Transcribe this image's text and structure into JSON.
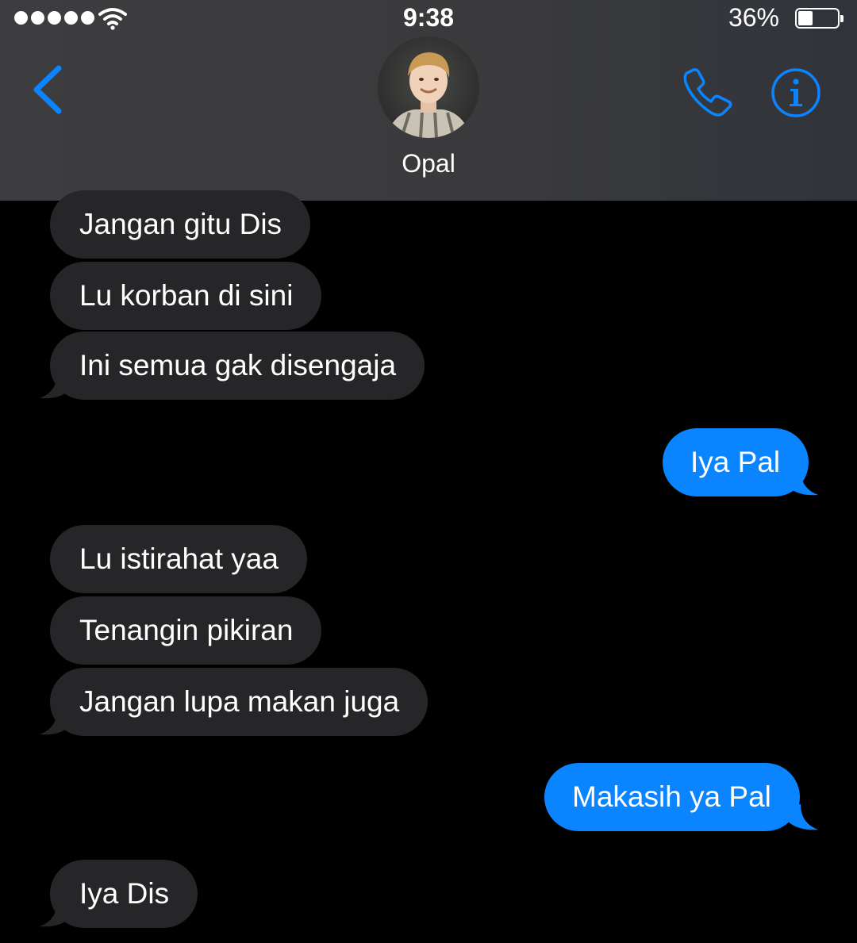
{
  "status_bar": {
    "time": "9:38",
    "battery_percent": "36%",
    "signal_bars": 5,
    "battery_level": 0.36
  },
  "header": {
    "contact_name": "Opal",
    "back_icon": "chevron-left-icon",
    "call_icon": "phone-icon",
    "info_icon": "info-icon",
    "accent_color": "#0a84ff"
  },
  "messages": [
    {
      "direction": "in",
      "text": "Jangan gitu Dis"
    },
    {
      "direction": "in",
      "text": "Lu korban di sini"
    },
    {
      "direction": "in",
      "text": "Ini semua gak disengaja"
    },
    {
      "direction": "out",
      "text": "Iya Pal"
    },
    {
      "direction": "in",
      "text": "Lu istirahat yaa"
    },
    {
      "direction": "in",
      "text": "Tenangin pikiran"
    },
    {
      "direction": "in",
      "text": "Jangan lupa makan juga"
    },
    {
      "direction": "out",
      "text": "Makasih ya Pal"
    },
    {
      "direction": "in",
      "text": "Iya Dis"
    }
  ],
  "colors": {
    "incoming_bubble": "#262629",
    "outgoing_bubble": "#0a84ff",
    "background": "#000000"
  }
}
